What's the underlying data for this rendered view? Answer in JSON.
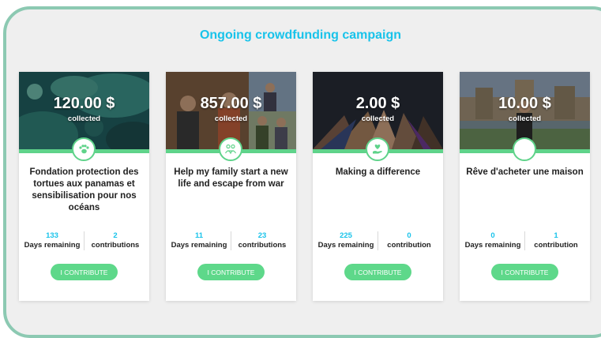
{
  "page": {
    "title": "Ongoing crowdfunding campaign"
  },
  "accent": {
    "cyan": "#19c3ea",
    "green": "#5ed88a",
    "frame": "#8cc9b2"
  },
  "campaigns": [
    {
      "amount": "120.00 $",
      "collected_label": "collected",
      "icon": "paw-icon",
      "title": "Fondation protection des tortues aux panamas et sensibilisation pour nos océans",
      "days": "133",
      "days_label": "Days remaining",
      "contributions": "2",
      "contributions_label": "contributions",
      "button": "I CONTRIBUTE"
    },
    {
      "amount": "857.00 $",
      "collected_label": "collected",
      "icon": "people-icon",
      "title": "Help my family start a new life and escape from war",
      "days": "11",
      "days_label": "Days remaining",
      "contributions": "23",
      "contributions_label": "contributions",
      "button": "I CONTRIBUTE"
    },
    {
      "amount": "2.00 $",
      "collected_label": "collected",
      "icon": "heart-hand-icon",
      "title": "Making a difference",
      "days": "225",
      "days_label": "Days remaining",
      "contributions": "0",
      "contributions_label": "contribution",
      "button": "I CONTRIBUTE"
    },
    {
      "amount": "10.00 $",
      "collected_label": "collected",
      "icon": "empty-icon",
      "title": "Rêve d'acheter une maison",
      "days": "0",
      "days_label": "Days remaining",
      "contributions": "1",
      "contributions_label": "contribution",
      "button": "I CONTRIBUTE"
    }
  ]
}
